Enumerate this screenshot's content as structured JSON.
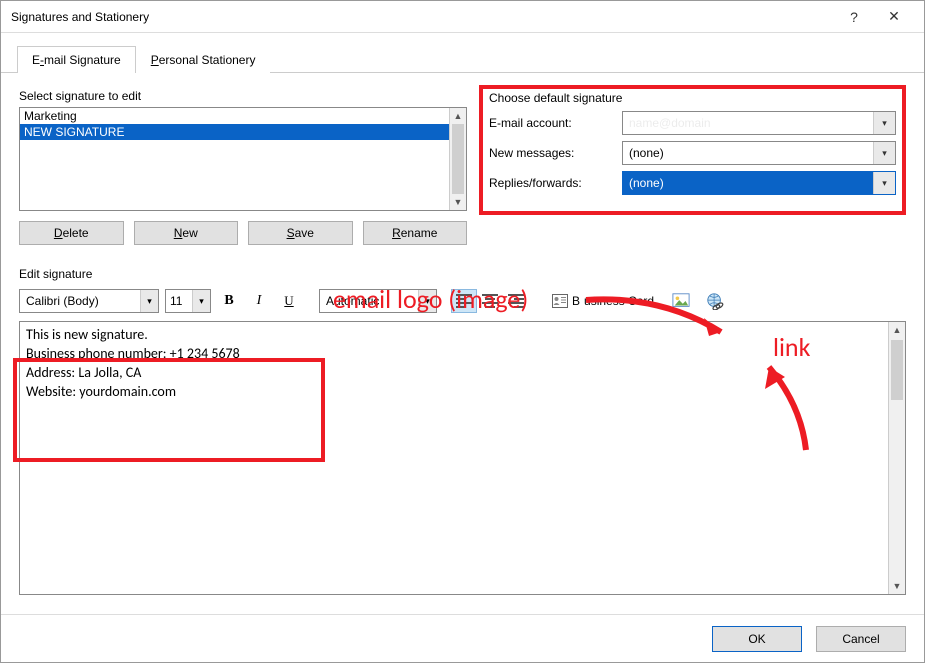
{
  "window": {
    "title": "Signatures and Stationery",
    "help_icon": "?",
    "close_icon": "✕"
  },
  "tabs": {
    "email_sig_pre": "E",
    "email_sig_ul": "-",
    "email_sig_post": "mail Signature",
    "stationery_ul": "P",
    "stationery_post": "ersonal Stationery"
  },
  "labels": {
    "select_sig": "Select signature to edit",
    "edit_sig": "Edit signature"
  },
  "signatures": {
    "items": [
      {
        "name": "Marketing"
      },
      {
        "name": "NEW SIGNATURE"
      }
    ]
  },
  "buttons": {
    "delete_ul": "D",
    "delete_post": "elete",
    "new_ul": "N",
    "new_post": "ew",
    "save_ul": "S",
    "save_post": "ave",
    "rename_ul": "R",
    "rename_post": "ename",
    "ok": "OK",
    "cancel": "Cancel"
  },
  "defaults": {
    "title": "Choose default signature",
    "email_account_pre": "E-mail a",
    "email_account_ul": "c",
    "email_account_post": "count:",
    "email_account_value": "name@domain",
    "new_msgs_pre": "New ",
    "new_msgs_ul": "m",
    "new_msgs_post": "essages:",
    "new_msgs_value": "(none)",
    "replies_pre": "Replies/",
    "replies_ul": "f",
    "replies_post": "orwards:",
    "replies_value": "(none)"
  },
  "toolbar": {
    "font": "Calibri (Body)",
    "size": "11",
    "bold": "B",
    "italic": "I",
    "underline": "U",
    "color": "Automatic",
    "bizcard_ul": "B",
    "bizcard_post": "usiness Card"
  },
  "editor": {
    "lines": [
      "This is new signature.",
      "Business phone number: +1 234 5678",
      "Address: La Jolla, CA",
      "Website: yourdomain.com"
    ]
  },
  "annotations": {
    "logo": "email logo (image)",
    "link": "link"
  }
}
